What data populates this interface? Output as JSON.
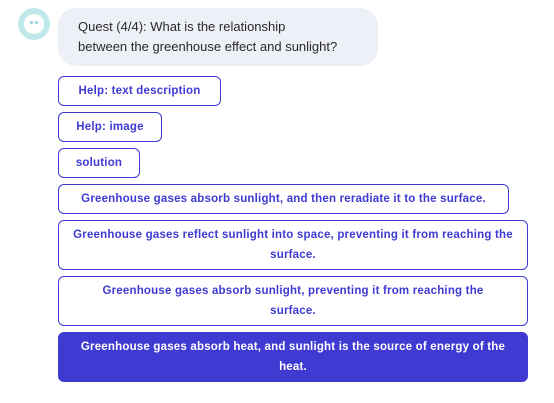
{
  "bot": {
    "avatar_icon": "smiley-bot-icon"
  },
  "chat": {
    "question_line1": "Quest (4/4): What is the relationship",
    "question_line2": "between the greenhouse effect and sunlight?"
  },
  "options": [
    {
      "label": "Help: text description",
      "selected": false
    },
    {
      "label": "Help: image",
      "selected": false
    },
    {
      "label": "solution",
      "selected": false
    },
    {
      "label": "Greenhouse gases absorb sunlight, and then reradiate it to the surface.",
      "selected": false
    },
    {
      "label": "Greenhouse gases reflect sunlight into space, preventing it from reaching the surface.",
      "selected": false
    },
    {
      "label": "Greenhouse gases absorb sunlight, preventing it from reaching the surface.",
      "selected": false
    },
    {
      "label": "Greenhouse gases absorb heat, and sunlight is the source of energy of the heat.",
      "selected": true
    }
  ],
  "colors": {
    "accent": "#3f3ad1",
    "avatar_bg": "#bfe8ea",
    "bubble_bg": "#eef0f7"
  }
}
